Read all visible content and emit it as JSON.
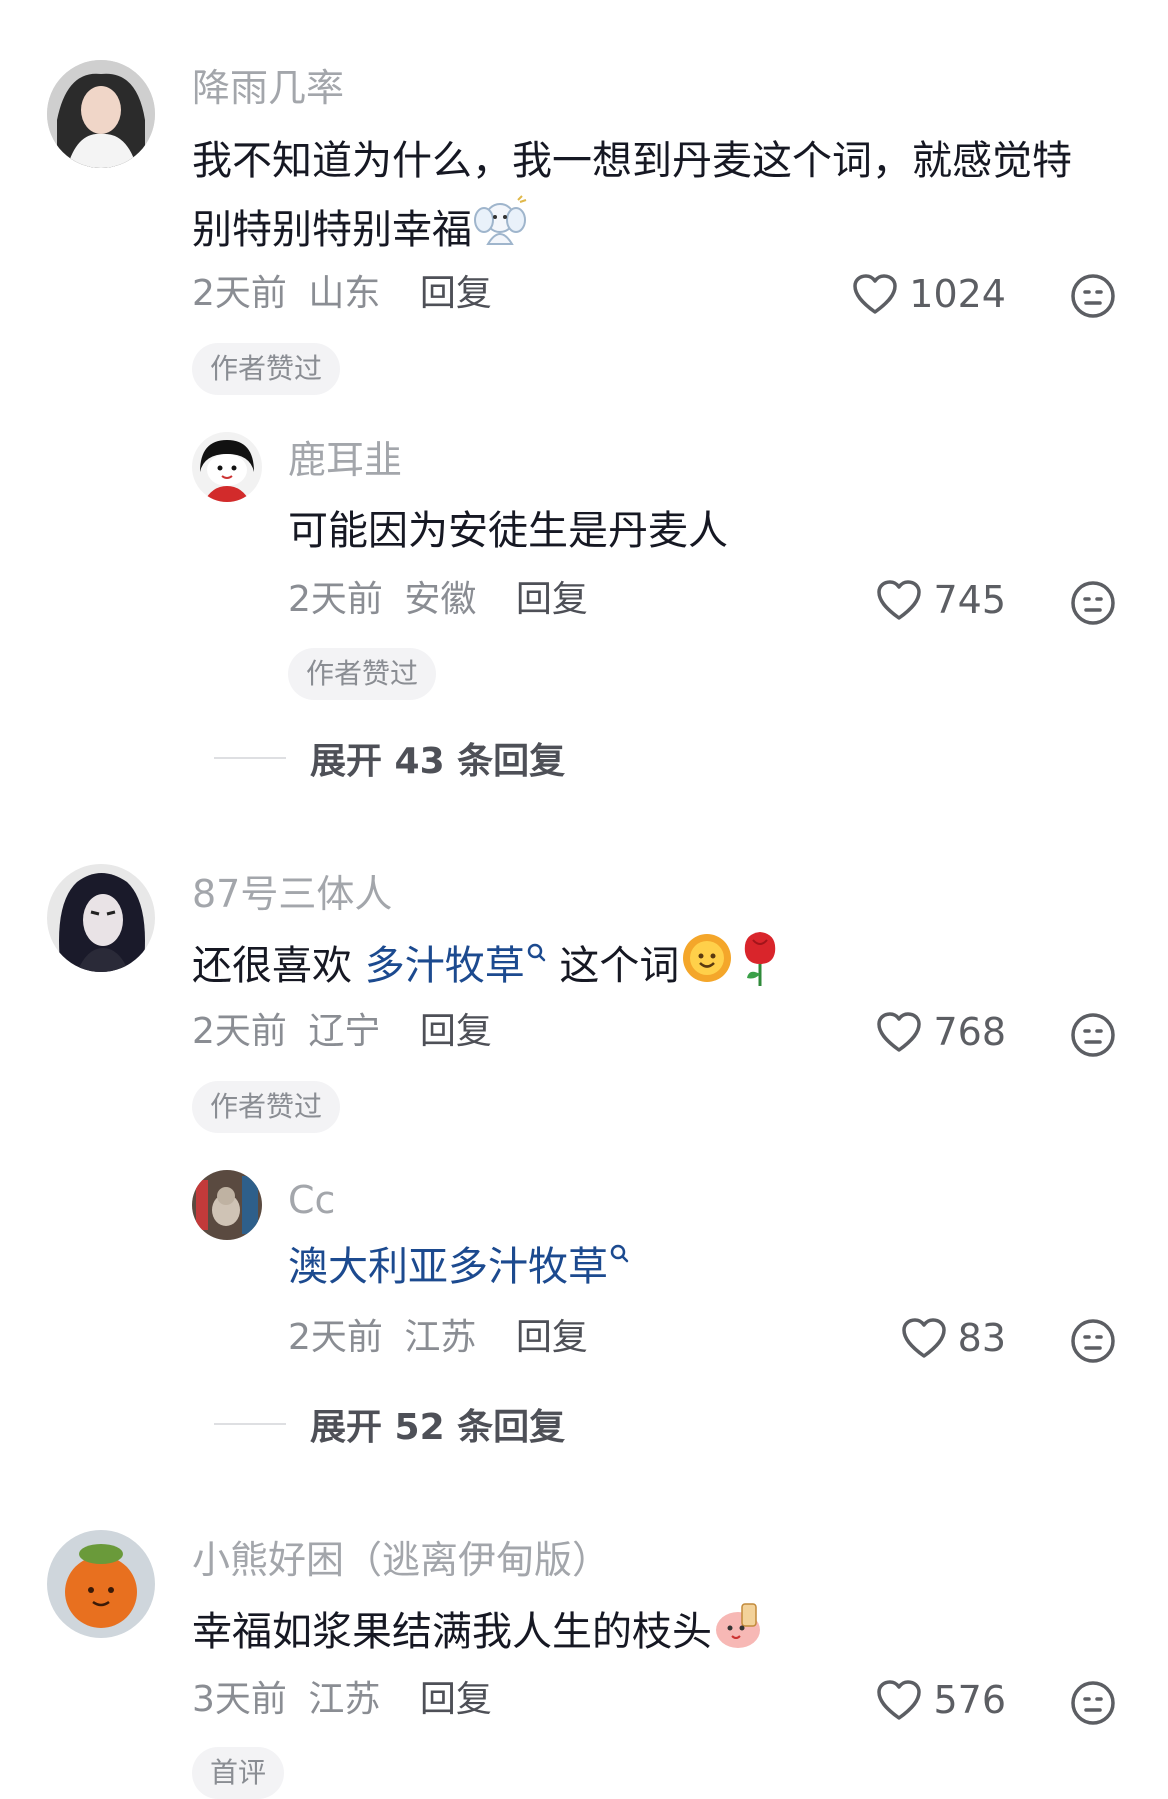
{
  "comments": [
    {
      "username": "降雨几率",
      "content_lines": [
        "我不知道为什么，我一想到丹麦这个词，就感觉特",
        "别特别特别幸福"
      ],
      "emoji": "angel-emoji",
      "time": "2天前",
      "location": "山东",
      "reply_label": "回复",
      "likes": "1024",
      "badge": "作者赞过",
      "replies": [
        {
          "username": "鹿耳韭",
          "content": "可能因为安徒生是丹麦人",
          "time": "2天前",
          "location": "安徽",
          "reply_label": "回复",
          "likes": "745",
          "badge": "作者赞过"
        }
      ],
      "expand_label": "展开 43 条回复"
    },
    {
      "username": "87号三体人",
      "content_prefix": "还很喜欢 ",
      "content_link": "多汁牧草",
      "content_suffix": " 这个词",
      "emojis": [
        "sun-smile-emoji",
        "rose-emoji"
      ],
      "time": "2天前",
      "location": "辽宁",
      "reply_label": "回复",
      "likes": "768",
      "badge": "作者赞过",
      "replies": [
        {
          "username": "Cc",
          "content_link": "澳大利亚多汁牧草",
          "time": "2天前",
          "location": "江苏",
          "reply_label": "回复",
          "likes": "83"
        }
      ],
      "expand_label": "展开 52 条回复"
    },
    {
      "username": "小熊好困（逃离伊甸版）",
      "content": "幸福如浆果结满我人生的枝头",
      "emoji": "peach-drink-emoji",
      "time": "3天前",
      "location": "江苏",
      "reply_label": "回复",
      "likes": "576",
      "badge": "首评"
    }
  ],
  "icons": {
    "like": "heart-outline-icon",
    "dislike": "neutral-face-icon",
    "search": "search-icon"
  },
  "colors": {
    "username": "#a3a6ab",
    "link": "#1c4a8f",
    "text": "#161823",
    "badge_bg": "#f3f3f5"
  }
}
